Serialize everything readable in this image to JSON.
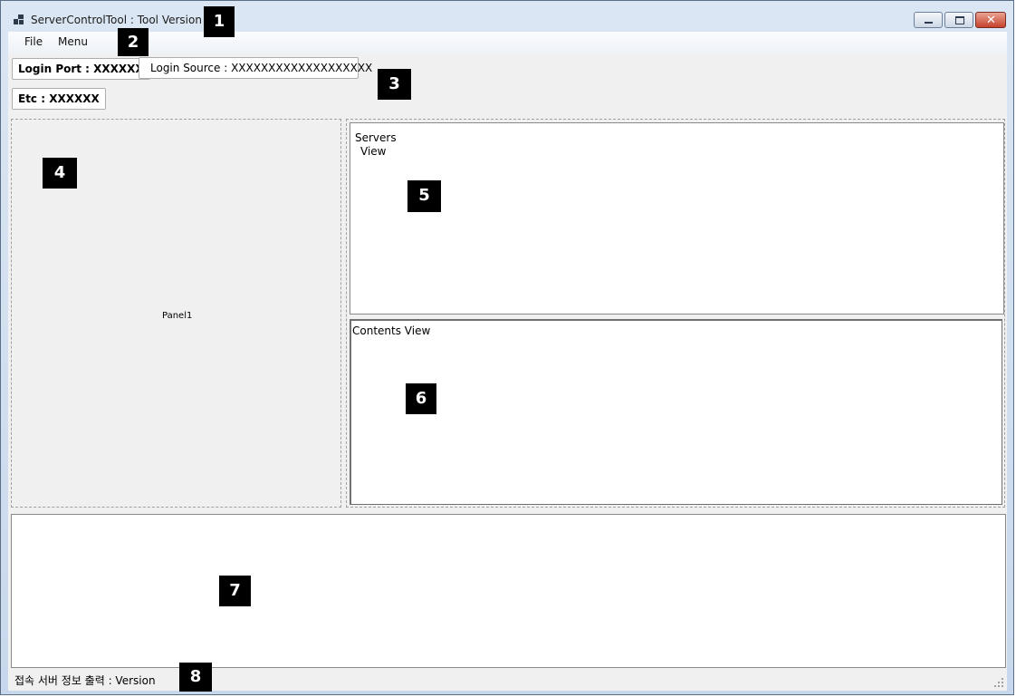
{
  "window": {
    "title": "ServerControlTool : Tool Version",
    "minimize_icon": "minimize-icon",
    "maximize_icon": "maximize-icon",
    "close_icon": "close-icon",
    "close_glyph": "✕"
  },
  "menubar": {
    "items": [
      {
        "label": "File"
      },
      {
        "label": "Menu"
      }
    ]
  },
  "toolbar": {
    "login_port": "Login Port : XXXXXX",
    "login_source": "Login Source : XXXXXXXXXXXXXXXXXXX",
    "etc": "Etc : XXXXXX"
  },
  "panel1": {
    "label": "Panel1"
  },
  "servers_view": {
    "label_line1": "Servers",
    "label_line2": "View"
  },
  "contents_view": {
    "label": "Contents View"
  },
  "statusbar": {
    "text": "접속 서버 정보 출력 : Version"
  },
  "badges": [
    "1",
    "2",
    "3",
    "4",
    "5",
    "6",
    "7",
    "8"
  ]
}
